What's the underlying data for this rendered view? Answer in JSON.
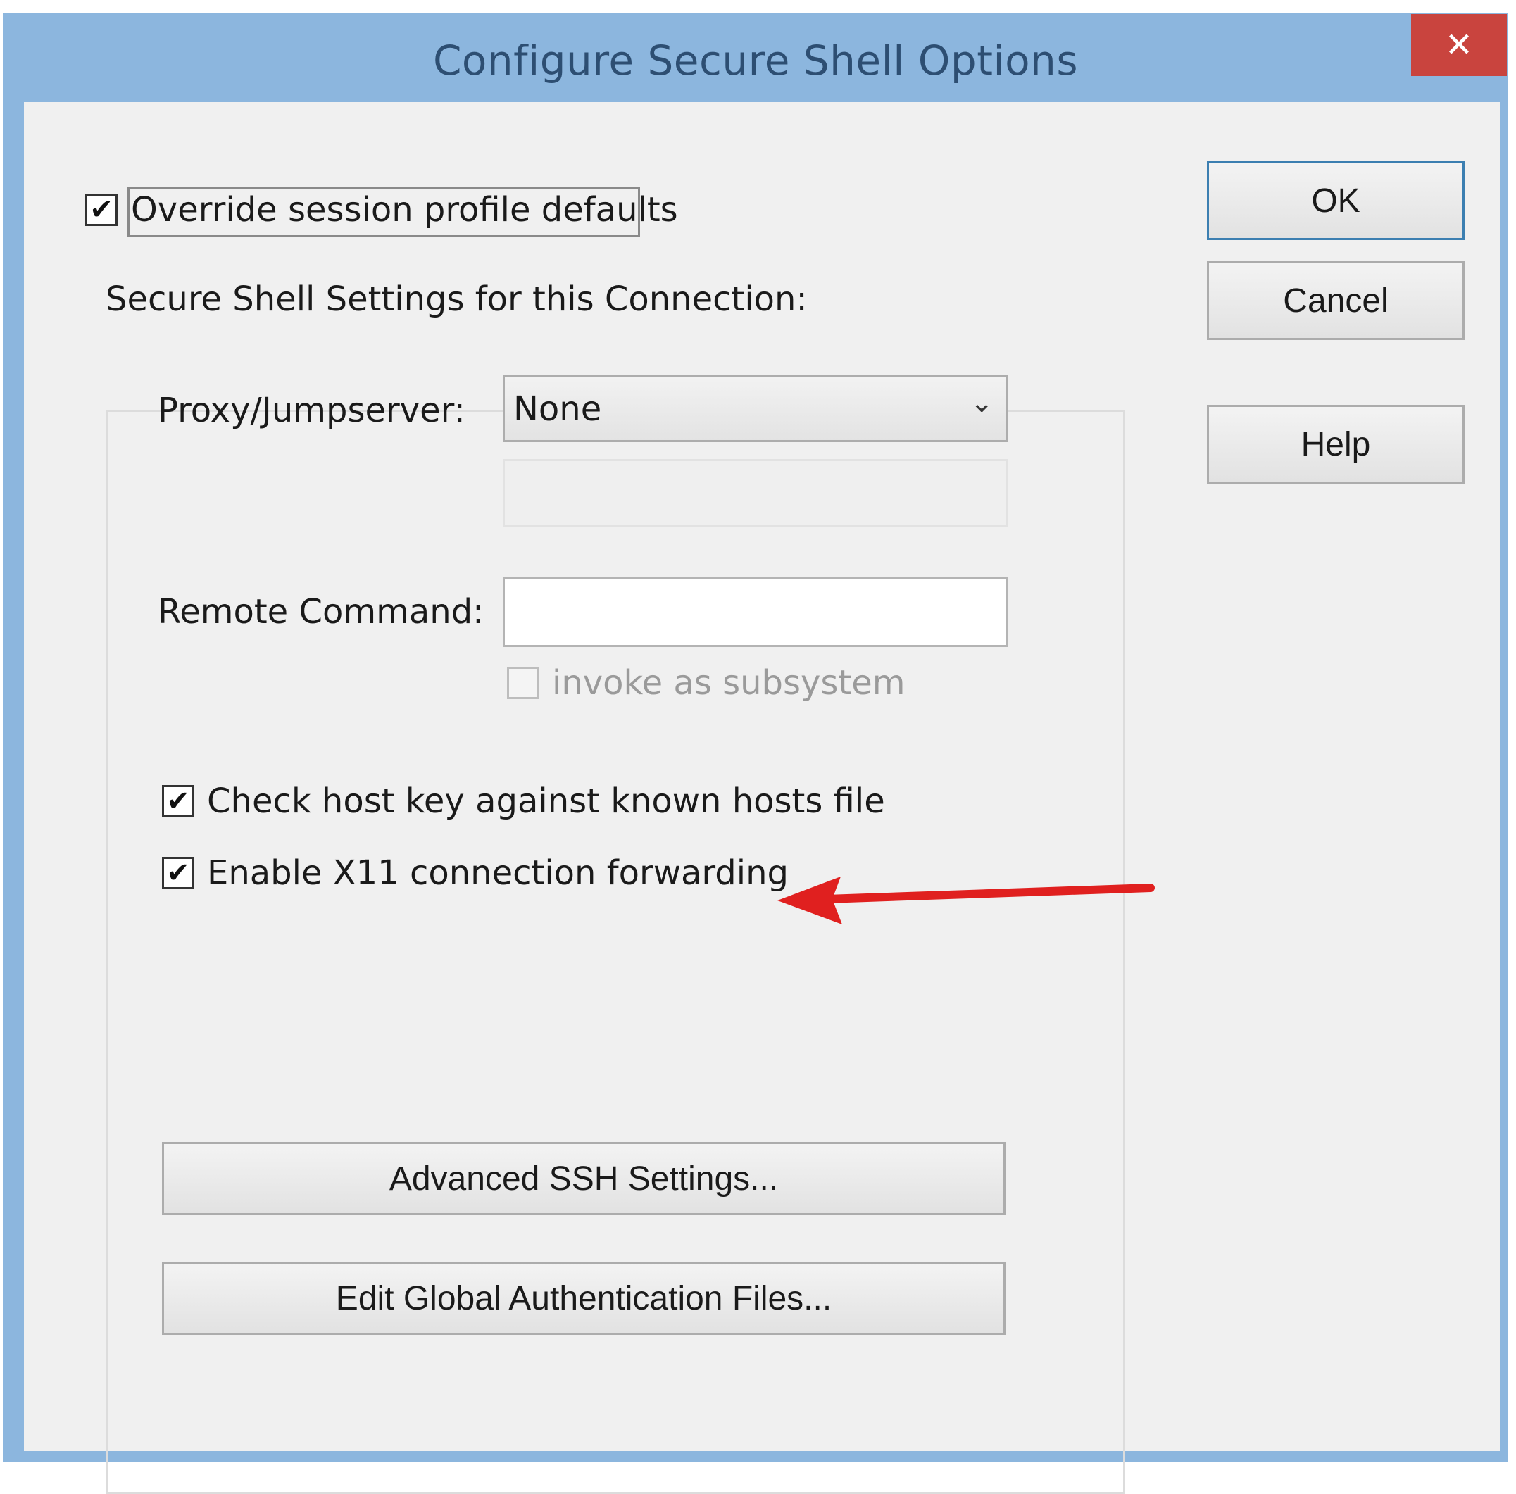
{
  "window": {
    "title": "Configure Secure Shell Options",
    "close_glyph": "✕"
  },
  "override": {
    "label": "Override session profile defaults",
    "checked": true
  },
  "group": {
    "caption": "Secure Shell Settings for this Connection:"
  },
  "proxy": {
    "label": "Proxy/Jumpserver:",
    "selected": "None"
  },
  "remote_command": {
    "label": "Remote Command:",
    "value": ""
  },
  "invoke_subsystem": {
    "label": "invoke as subsystem",
    "checked": false,
    "enabled": false
  },
  "check_host_key": {
    "label": "Check host key against known hosts file",
    "checked": true
  },
  "x11_forwarding": {
    "label": "Enable X11 connection forwarding",
    "checked": true
  },
  "buttons": {
    "ok": "OK",
    "cancel": "Cancel",
    "help": "Help",
    "advanced": "Advanced SSH Settings...",
    "edit_global": "Edit Global Authentication Files..."
  },
  "icons": {
    "check": "✔",
    "chevron": "⌄"
  },
  "colors": {
    "titlebar": "#8cb6de",
    "close_button": "#c9443e",
    "annotation_arrow": "#e0201f"
  }
}
